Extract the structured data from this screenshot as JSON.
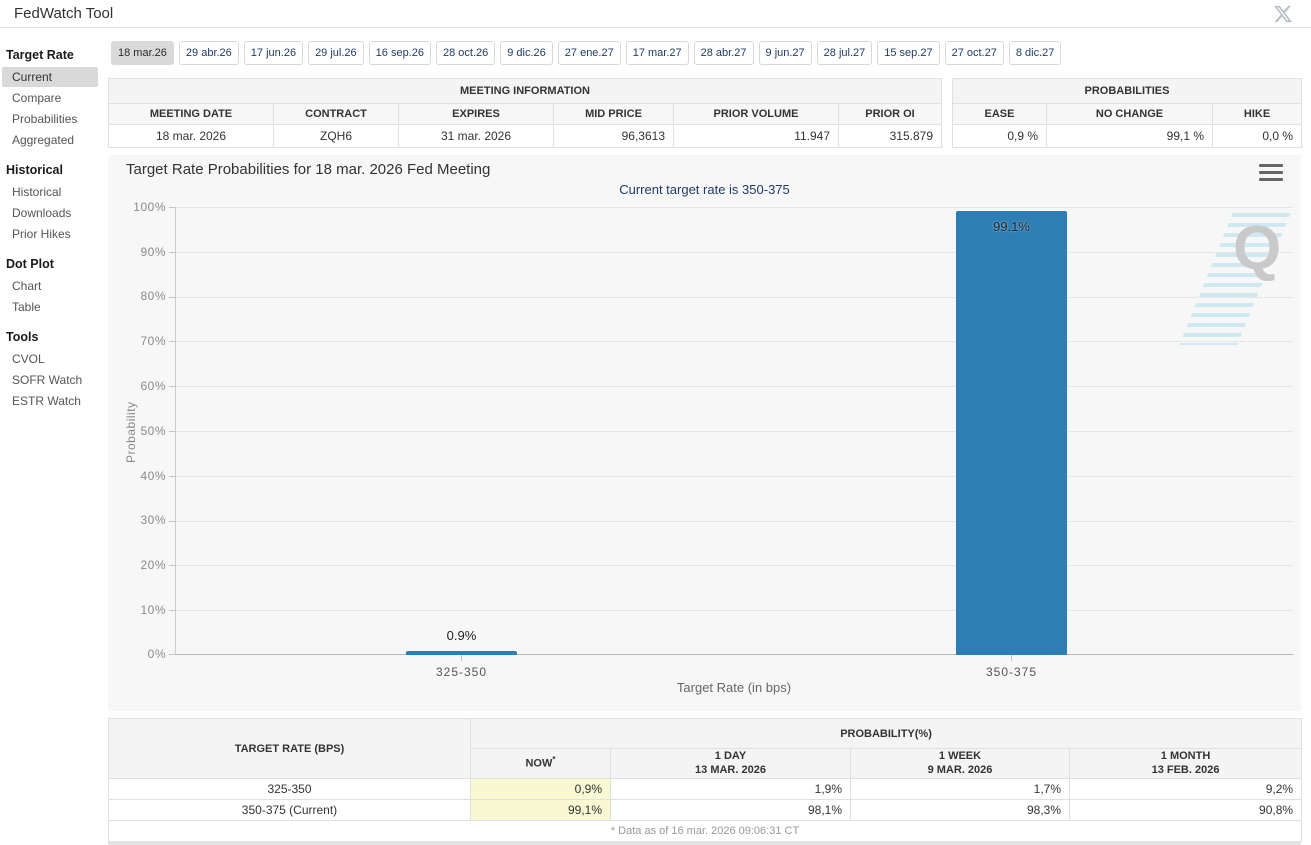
{
  "header": {
    "title": "FedWatch Tool",
    "social_icon": "x-logo"
  },
  "sidebar": {
    "sections": [
      {
        "header": "Target Rate",
        "items": [
          {
            "label": "Current",
            "selected": true
          },
          {
            "label": "Compare",
            "selected": false
          },
          {
            "label": "Probabilities",
            "selected": false
          },
          {
            "label": "Aggregated",
            "selected": false
          }
        ]
      },
      {
        "header": "Historical",
        "items": [
          {
            "label": "Historical",
            "selected": false
          },
          {
            "label": "Downloads",
            "selected": false
          },
          {
            "label": "Prior Hikes",
            "selected": false
          }
        ]
      },
      {
        "header": "Dot Plot",
        "items": [
          {
            "label": "Chart",
            "selected": false
          },
          {
            "label": "Table",
            "selected": false
          }
        ]
      },
      {
        "header": "Tools",
        "items": [
          {
            "label": "CVOL",
            "selected": false
          },
          {
            "label": "SOFR Watch",
            "selected": false
          },
          {
            "label": "ESTR Watch",
            "selected": false
          }
        ]
      }
    ]
  },
  "tabs": [
    {
      "label": "18 mar.26",
      "selected": true
    },
    {
      "label": "29 abr.26",
      "selected": false
    },
    {
      "label": "17 jun.26",
      "selected": false
    },
    {
      "label": "29 jul.26",
      "selected": false
    },
    {
      "label": "16 sep.26",
      "selected": false
    },
    {
      "label": "28 oct.26",
      "selected": false
    },
    {
      "label": "9 dic.26",
      "selected": false
    },
    {
      "label": "27 ene.27",
      "selected": false
    },
    {
      "label": "17 mar.27",
      "selected": false
    },
    {
      "label": "28 abr.27",
      "selected": false
    },
    {
      "label": "9 jun.27",
      "selected": false
    },
    {
      "label": "28 jul.27",
      "selected": false
    },
    {
      "label": "15 sep.27",
      "selected": false
    },
    {
      "label": "27 oct.27",
      "selected": false
    },
    {
      "label": "8 dic.27",
      "selected": false
    }
  ],
  "meeting_info": {
    "title": "MEETING INFORMATION",
    "columns": [
      "MEETING DATE",
      "CONTRACT",
      "EXPIRES",
      "MID PRICE",
      "PRIOR VOLUME",
      "PRIOR OI"
    ],
    "values": [
      "18 mar. 2026",
      "ZQH6",
      "31 mar. 2026",
      "96,3613",
      "11.947",
      "315.879"
    ]
  },
  "probabilities": {
    "title": "PROBABILITIES",
    "columns": [
      "EASE",
      "NO CHANGE",
      "HIKE"
    ],
    "values": [
      "0,9 %",
      "99,1 %",
      "0,0 %"
    ]
  },
  "chart_data": {
    "type": "bar",
    "title": "Target Rate Probabilities for 18 mar. 2026 Fed Meeting",
    "subtitle": "Current target rate is 350-375",
    "categories": [
      "325-350",
      "350-375"
    ],
    "values": [
      0.9,
      99.1
    ],
    "value_labels": [
      "0.9%",
      "99.1%"
    ],
    "xlabel": "Target Rate (in bps)",
    "ylabel": "Probability",
    "ylim": [
      0,
      100
    ],
    "y_ticks": [
      "0%",
      "10%",
      "20%",
      "30%",
      "40%",
      "50%",
      "60%",
      "70%",
      "80%",
      "90%",
      "100%"
    ],
    "grid": "horizontal-dotted",
    "legend": "none",
    "bar_color": "#2d7eb5",
    "menu_icon": "hamburger-icon",
    "watermark_letter": "Q"
  },
  "bottom_table": {
    "rate_col_header": "TARGET RATE (BPS)",
    "group_header": "PROBABILITY(%)",
    "sub_headers": [
      {
        "line1": "NOW",
        "sup": "*",
        "line2": ""
      },
      {
        "line1": "1 DAY",
        "line2": "13 MAR. 2026"
      },
      {
        "line1": "1 WEEK",
        "line2": "9 MAR. 2026"
      },
      {
        "line1": "1 MONTH",
        "line2": "13 FEB. 2026"
      }
    ],
    "rows": [
      {
        "rate": "325-350",
        "now": "0,9%",
        "day": "1,9%",
        "week": "1,7%",
        "month": "9,2%"
      },
      {
        "rate": "350-375 (Current)",
        "now": "99,1%",
        "day": "98,1%",
        "week": "98,3%",
        "month": "90,8%"
      }
    ],
    "footnote": "* Data as of 16 mar. 2026 09:06:31 CT"
  },
  "colors": {
    "accent_navy": "#1f3a68",
    "selected_gray": "#d9d9d9",
    "highlight_yellow": "#f8f8d2",
    "chart_bg": "#f7f7f7"
  }
}
